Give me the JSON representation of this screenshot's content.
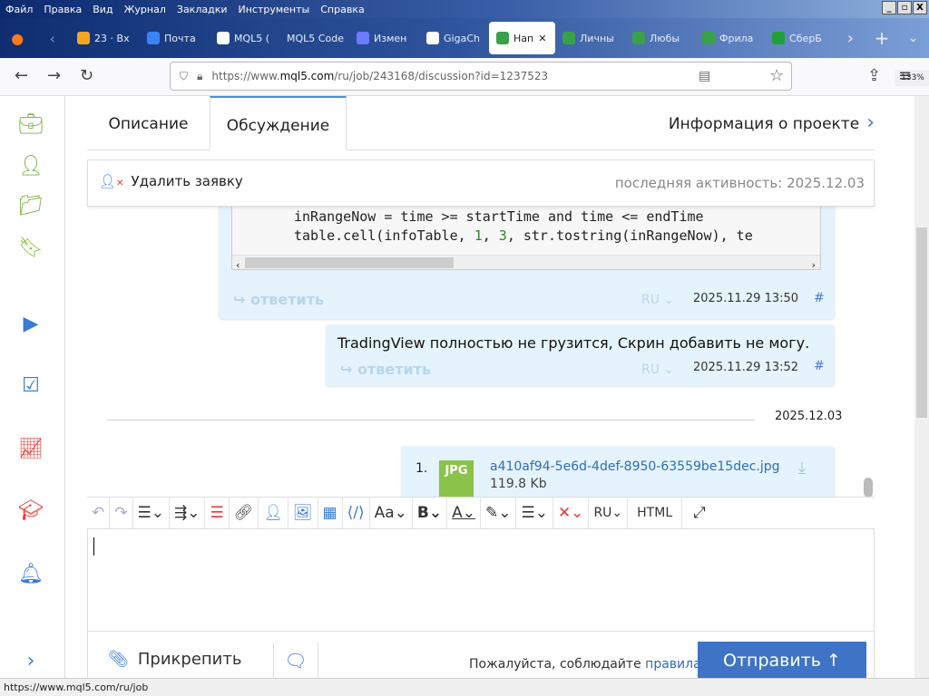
{
  "menu": [
    "Файл",
    "Правка",
    "Вид",
    "Журнал",
    "Закладки",
    "Инструменты",
    "Справка"
  ],
  "browser_tabs": [
    {
      "label": "23 · Вх",
      "color": "#f5a623"
    },
    {
      "label": "Почта",
      "color": "#3b82f6"
    },
    {
      "label": "MQL5 (",
      "color": "#ffffff"
    },
    {
      "label": "MQL5 Code",
      "color": ""
    },
    {
      "label": "Измен",
      "color": "#6b7cff"
    },
    {
      "label": "GigaCh",
      "color": "#ffffff"
    },
    {
      "label": "Нап",
      "color": "#3aa04a",
      "active": true
    },
    {
      "label": "Личны",
      "color": "#3aa04a"
    },
    {
      "label": "Любы",
      "color": "#3aa04a"
    },
    {
      "label": "Фрила",
      "color": "#3aa04a"
    },
    {
      "label": "СберБ",
      "color": "#21a038"
    }
  ],
  "url": {
    "prefix": "https://www.",
    "domain": "mql5.com",
    "path": "/ru/job/243168/discussion?id=1237523"
  },
  "zoom": "133%",
  "page_tabs": {
    "description": "Описание",
    "discussion": "Обсуждение",
    "info": "Информация о проекте"
  },
  "header": {
    "delete": "Удалить заявку",
    "activity_label": "последняя активность:",
    "activity_date": "2025.12.03"
  },
  "messages": [
    {
      "code_line1": "inRangeNow = time >= startTime and time <= endTime",
      "code_line2_a": "table.cell(infoTable, ",
      "n1": "1",
      "code_line2_b": ", ",
      "n2": "3",
      "code_line2_c": ", str.tostring(inRangeNow), te",
      "reply": "ответить",
      "lang": "RU",
      "time": "2025.11.29 13:50",
      "hash": "#"
    },
    {
      "text": "TradingView полностью не грузится, Скрин добавить не могу.",
      "reply": "ответить",
      "lang": "RU",
      "time": "2025.11.29 13:52",
      "hash": "#"
    }
  ],
  "separator_date": "2025.12.03",
  "attachment": {
    "index": "1.",
    "type": "JPG",
    "name": "a410af94-5e6d-4def-8950-63559be15dec.jpg",
    "size": "119.8 Kb"
  },
  "toolbar": {
    "lang": "RU",
    "html": "HTML",
    "font": "Aa"
  },
  "bottom": {
    "attach": "Прикрепить",
    "rules_prefix": "Пожалуйста, соблюдайте",
    "rules_link": "правила",
    "send": "Отправить"
  },
  "status_url": "https://www.mql5.com/ru/job"
}
